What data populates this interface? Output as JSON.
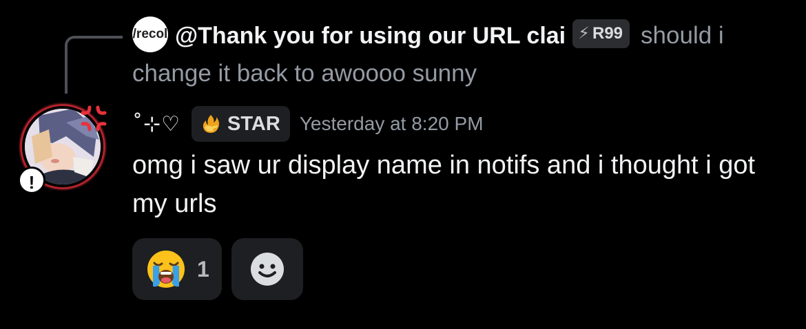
{
  "reply": {
    "avatar_text": "/recol",
    "author": "@Thank you for using our URL clai",
    "author_tag": "R99",
    "text": "should i change it back to awoooo sunny"
  },
  "message": {
    "username": "˚⊹♡",
    "tag": "STAR",
    "timestamp": "Yesterday at 8:20 PM",
    "content": "omg i saw ur display name in notifs and i thought i got my urls"
  },
  "reactions": [
    {
      "emoji_name": "loudly-crying-face",
      "count": "1"
    }
  ],
  "icons": {
    "tag_bolt": "lightning-icon",
    "star_tag": "fire-hand-icon",
    "add_reaction": "smiley-face-icon",
    "avatar_anger": "anger-symbol-icon",
    "avatar_alert": "exclamation-icon"
  },
  "colors": {
    "background": "#000000",
    "reaction_bg": "#1e1f22",
    "muted_text": "#949ba4",
    "ring": "#b4232c"
  }
}
